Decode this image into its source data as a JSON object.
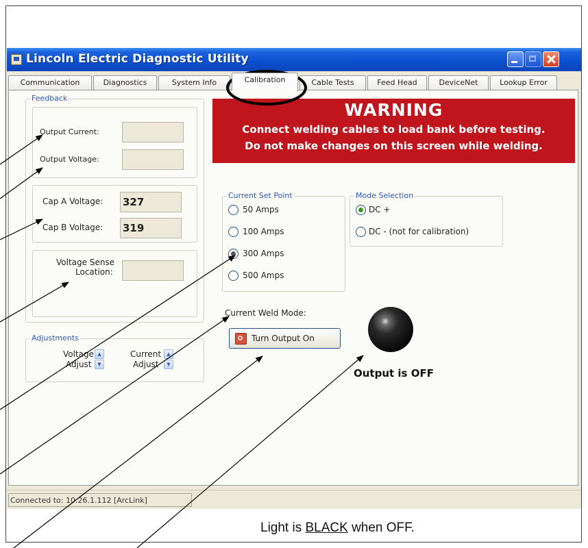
{
  "window": {
    "title": "Lincoln Electric Diagnostic Utility"
  },
  "tabs": [
    {
      "label": "Communication"
    },
    {
      "label": "Diagnostics"
    },
    {
      "label": "System Info"
    },
    {
      "label": "Calibration",
      "active": true
    },
    {
      "label": "Cable Tests"
    },
    {
      "label": "Feed Head"
    },
    {
      "label": "DeviceNet"
    },
    {
      "label": "Lookup Error"
    }
  ],
  "feedback": {
    "legend": "Feedback",
    "output_current_label": "Output Current:",
    "output_current_value": "",
    "output_voltage_label": "Output Voltage:",
    "output_voltage_value": "",
    "cap_a_label": "Cap A Voltage:",
    "cap_a_value": "327",
    "cap_b_label": "Cap B Voltage:",
    "cap_b_value": "319",
    "voltage_sense_label_line1": "Voltage Sense",
    "voltage_sense_label_line2": "Location:",
    "voltage_sense_value": ""
  },
  "adjustments": {
    "legend": "Adjustments",
    "voltage_label_line1": "Voltage",
    "voltage_label_line2": "Adjust",
    "current_label_line1": "Current",
    "current_label_line2": "Adjust"
  },
  "warning": {
    "title": "WARNING",
    "line1": "Connect welding cables to load bank before testing.",
    "line2": "Do not make changes on this screen while welding.",
    "color": "#c0151c"
  },
  "current_set_point": {
    "legend": "Current Set Point",
    "options": [
      {
        "label": "50 Amps",
        "checked": false
      },
      {
        "label": "100 Amps",
        "checked": false
      },
      {
        "label": "300 Amps",
        "checked": true
      },
      {
        "label": "500 Amps",
        "checked": false
      }
    ]
  },
  "mode_selection": {
    "legend": "Mode Selection",
    "options": [
      {
        "label": "DC +",
        "checked": true
      },
      {
        "label": "DC - (not for calibration)",
        "checked": false
      }
    ]
  },
  "weld": {
    "current_weld_mode_label": "Current Weld Mode:",
    "turn_output_button": "Turn Output On",
    "output_status": "Output is OFF",
    "light_color": "black"
  },
  "status_bar": {
    "text": "Connected to: 10.26.1.112 [ArcLink]"
  },
  "caption": {
    "prefix": "Light is ",
    "emphasis": "BLACK",
    "suffix": " when OFF."
  }
}
